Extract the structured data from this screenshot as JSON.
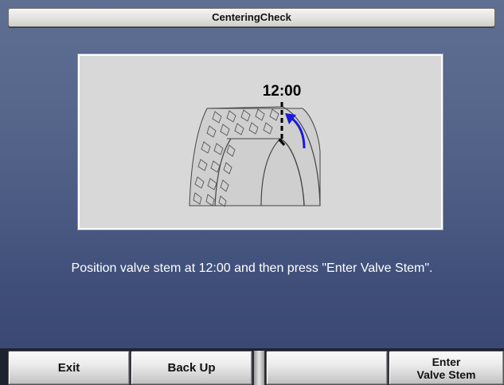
{
  "window": {
    "title": "CenteringCheck"
  },
  "illustration": {
    "clock_label": "12:00"
  },
  "instruction": "Position valve stem at 12:00 and then press \"Enter Valve Stem\".",
  "toolbar": {
    "exit_label": "Exit",
    "back_label": "Back Up",
    "empty_label": "",
    "enter_label": "Enter\nValve Stem"
  },
  "colors": {
    "arrow": "#1a1adc",
    "panel": "#d8d8d8"
  }
}
